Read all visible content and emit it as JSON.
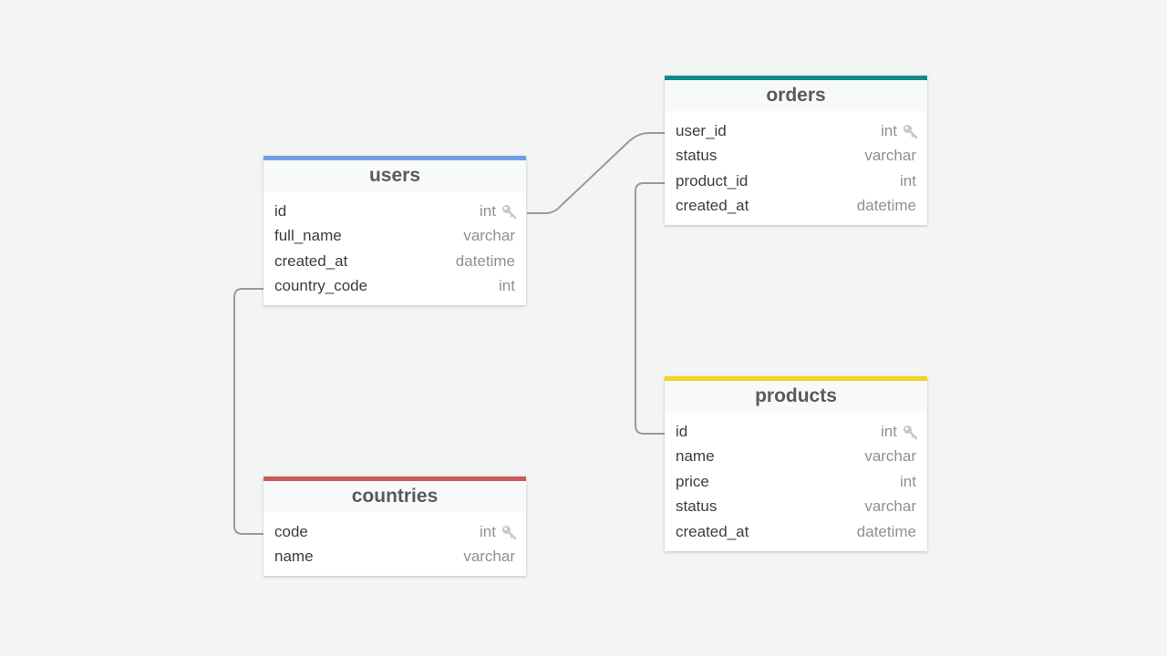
{
  "colors": {
    "background": "#f3f5f5",
    "relation_line": "#9a9a9a",
    "users_accent": "#6f9ee6",
    "orders_accent": "#13898a",
    "countries_accent": "#c55b5b",
    "products_accent": "#f3d320",
    "key_icon": "#c8c8c8"
  },
  "tables": {
    "users": {
      "title": "users",
      "columns": [
        {
          "name": "id",
          "type": "int",
          "primary_key": true
        },
        {
          "name": "full_name",
          "type": "varchar",
          "primary_key": false
        },
        {
          "name": "created_at",
          "type": "datetime",
          "primary_key": false
        },
        {
          "name": "country_code",
          "type": "int",
          "primary_key": false
        }
      ]
    },
    "orders": {
      "title": "orders",
      "columns": [
        {
          "name": "user_id",
          "type": "int",
          "primary_key": true
        },
        {
          "name": "status",
          "type": "varchar",
          "primary_key": false
        },
        {
          "name": "product_id",
          "type": "int",
          "primary_key": false
        },
        {
          "name": "created_at",
          "type": "datetime",
          "primary_key": false
        }
      ]
    },
    "countries": {
      "title": "countries",
      "columns": [
        {
          "name": "code",
          "type": "int",
          "primary_key": true
        },
        {
          "name": "name",
          "type": "varchar",
          "primary_key": false
        }
      ]
    },
    "products": {
      "title": "products",
      "columns": [
        {
          "name": "id",
          "type": "int",
          "primary_key": true
        },
        {
          "name": "name",
          "type": "varchar",
          "primary_key": false
        },
        {
          "name": "price",
          "type": "int",
          "primary_key": false
        },
        {
          "name": "status",
          "type": "varchar",
          "primary_key": false
        },
        {
          "name": "created_at",
          "type": "datetime",
          "primary_key": false
        }
      ]
    }
  },
  "relations": [
    {
      "from": "users.id",
      "to": "orders.user_id"
    },
    {
      "from": "orders.product_id",
      "to": "products.id"
    },
    {
      "from": "users.country_code",
      "to": "countries.code"
    }
  ]
}
